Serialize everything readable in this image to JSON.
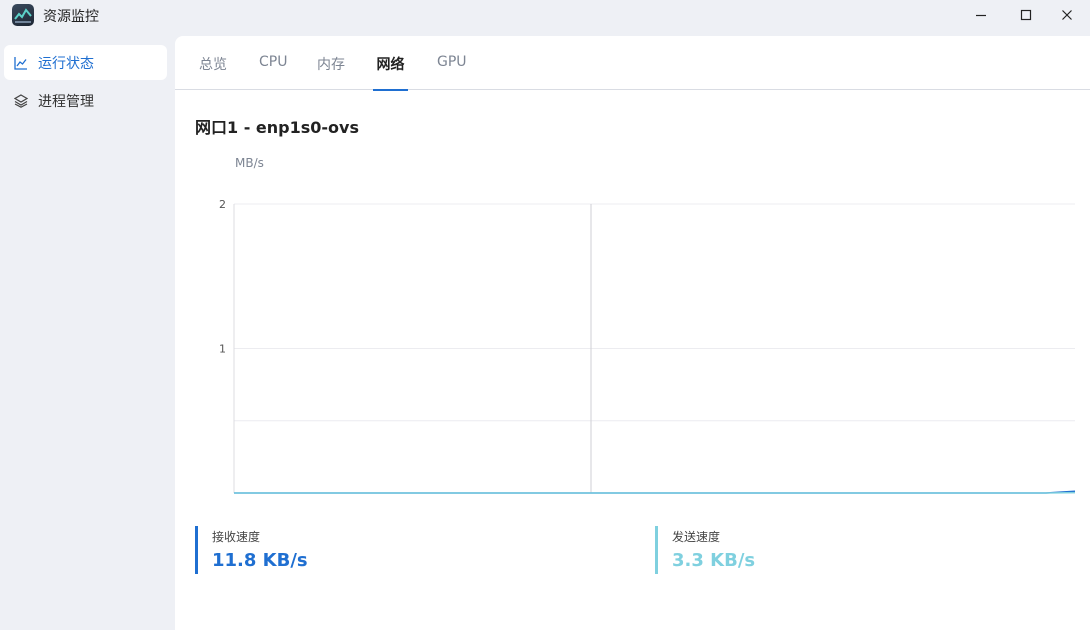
{
  "window": {
    "title": "资源监控",
    "icons": {
      "app": "monitor-app-icon",
      "minimize": "minimize-icon",
      "maximize": "maximize-icon",
      "close": "close-icon"
    }
  },
  "sidebar": {
    "items": [
      {
        "label": "运行状态",
        "icon": "line-chart-icon",
        "active": true
      },
      {
        "label": "进程管理",
        "icon": "layers-icon",
        "active": false
      }
    ]
  },
  "tabs": [
    {
      "label": "总览",
      "active": false
    },
    {
      "label": "CPU",
      "active": false
    },
    {
      "label": "内存",
      "active": false
    },
    {
      "label": "网络",
      "active": true
    },
    {
      "label": "GPU",
      "active": false
    }
  ],
  "network": {
    "interface_title": "网口1 - enp1s0-ovs",
    "unit": "MB/s",
    "rx": {
      "label": "接收速度",
      "value": "11.8 KB/s",
      "color": "#1f6fd1"
    },
    "tx": {
      "label": "发送速度",
      "value": "3.3 KB/s",
      "color": "#7fd0df"
    }
  },
  "chart_data": {
    "type": "area",
    "ylabel": "MB/s",
    "ylim": [
      0,
      2
    ],
    "yticks": [
      "1",
      "2"
    ],
    "grid": true,
    "series": [
      {
        "name": "接收速度",
        "color": "#1f6fd1",
        "values": [
          0.0,
          0.0,
          0.0,
          0.0,
          0.0,
          0.0,
          0.0,
          0.0,
          0.0,
          0.0,
          0.0,
          0.0,
          0.0,
          0.0,
          0.0,
          0.0,
          0.0,
          0.0,
          0.0,
          0.0,
          0.0,
          0.0,
          0.0,
          0.0,
          0.0,
          0.0,
          0.0,
          0.0,
          0.0,
          0.012
        ]
      },
      {
        "name": "发送速度",
        "color": "#7fd0df",
        "values": [
          0.0,
          0.0,
          0.0,
          0.0,
          0.0,
          0.0,
          0.0,
          0.0,
          0.0,
          0.0,
          0.0,
          0.0,
          0.0,
          0.0,
          0.0,
          0.0,
          0.0,
          0.0,
          0.0,
          0.0,
          0.0,
          0.0,
          0.0,
          0.0,
          0.0,
          0.0,
          0.0,
          0.0,
          0.0,
          0.003
        ]
      }
    ]
  }
}
